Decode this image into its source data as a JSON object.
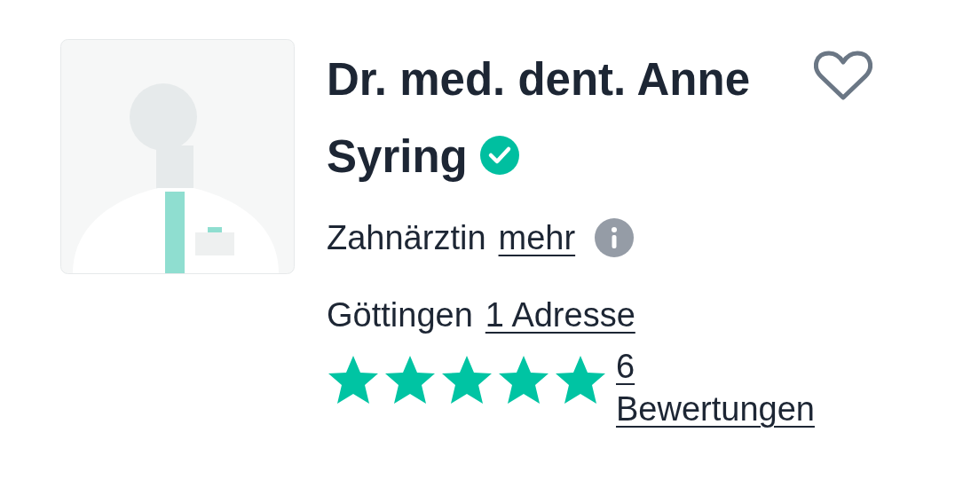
{
  "doctor": {
    "name": "Dr. med. dent. Anne Syring",
    "verified": true,
    "favorite": false,
    "specialty": "Zahnärztin",
    "more_link": "mehr",
    "city": "Göttingen",
    "address_link": "1 Adresse",
    "stars": 5,
    "reviews_link": "6 Bewertungen"
  }
}
